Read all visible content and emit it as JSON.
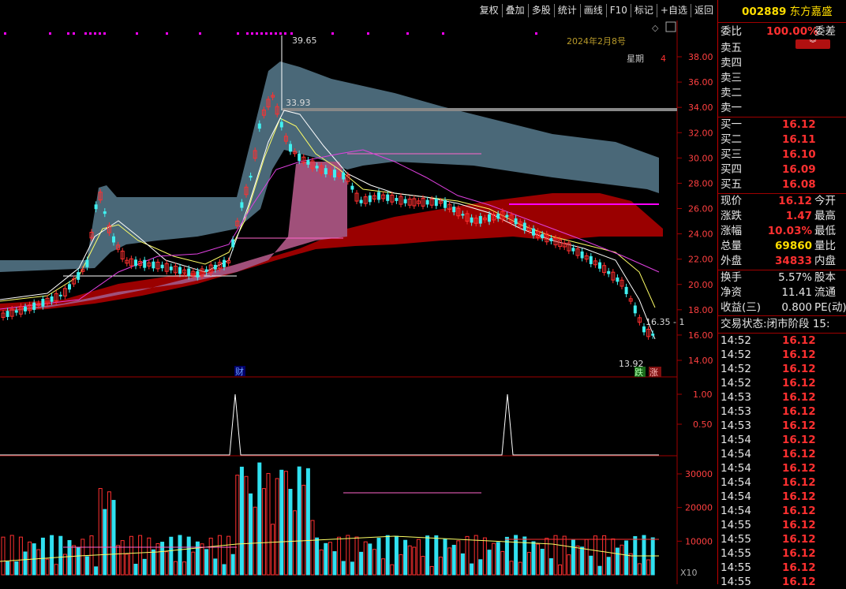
{
  "toolbar": [
    "复权",
    "叠加",
    "多股",
    "统计",
    "画线",
    "F10",
    "标记",
    "+自选",
    "返回"
  ],
  "stock": {
    "code": "002889",
    "name": "东方嘉盛"
  },
  "chart": {
    "date_label": "2024年2月8号",
    "weekday_label": "星期",
    "weekday_value": "4",
    "high_label": "39.65",
    "label_3393": "33.93",
    "low_label": "13.92",
    "right_label": "16.35 - 1",
    "fin_marker": "财",
    "die_marker": "跌",
    "zhang_marker": "涨",
    "x10_label": "X10",
    "price_ticks": [
      "38.00",
      "36.00",
      "34.00",
      "32.00",
      "30.00",
      "28.00",
      "26.00",
      "24.00",
      "22.00",
      "20.00",
      "18.00",
      "16.00",
      "14.00"
    ],
    "ind_ticks": [
      "1.00",
      "0.50"
    ],
    "vol_ticks": [
      "30000",
      "20000",
      "10000"
    ]
  },
  "chart_data": {
    "type": "candlestick",
    "price_axis": {
      "ticks": [
        38,
        36,
        34,
        32,
        30,
        28,
        26,
        24,
        22,
        20,
        18,
        16,
        14
      ]
    },
    "marked_high": 39.65,
    "marked_low": 13.92,
    "indicator_axis": {
      "ticks": [
        1.0,
        0.5
      ]
    },
    "volume_axis": {
      "ticks": [
        30000,
        20000,
        10000
      ]
    }
  },
  "side": {
    "weibi": {
      "label": "委比",
      "value": "100.00%",
      "label2": "委差"
    },
    "sells": [
      {
        "label": "卖五"
      },
      {
        "label": "卖四"
      },
      {
        "label": "卖三"
      },
      {
        "label": "卖二"
      },
      {
        "label": "卖一"
      }
    ],
    "buys": [
      {
        "label": "买一",
        "price": "16.12"
      },
      {
        "label": "买二",
        "price": "16.11"
      },
      {
        "label": "买三",
        "price": "16.10"
      },
      {
        "label": "买四",
        "price": "16.09"
      },
      {
        "label": "买五",
        "price": "16.08"
      }
    ],
    "quote": [
      {
        "label": "现价",
        "value": "16.12",
        "label2": "今开",
        "color": "red"
      },
      {
        "label": "涨跌",
        "value": "1.47",
        "label2": "最高",
        "color": "red"
      },
      {
        "label": "涨幅",
        "value": "10.03%",
        "label2": "最低",
        "color": "red"
      },
      {
        "label": "总量",
        "value": "69860",
        "label2": "量比",
        "color": "yel"
      },
      {
        "label": "外盘",
        "value": "34833",
        "label2": "内盘",
        "color": "red"
      }
    ],
    "stats": [
      {
        "label": "换手",
        "value": "5.57%",
        "label2": "股本"
      },
      {
        "label": "净资",
        "value": "11.41",
        "label2": "流通"
      },
      {
        "label": "收益(三)",
        "value": "0.800",
        "label2": "PE(动)"
      }
    ],
    "trade_status": "交易状态:闭市阶段 15:",
    "ticks": [
      {
        "time": "14:52",
        "price": "16.12"
      },
      {
        "time": "14:52",
        "price": "16.12"
      },
      {
        "time": "14:52",
        "price": "16.12"
      },
      {
        "time": "14:52",
        "price": "16.12"
      },
      {
        "time": "14:53",
        "price": "16.12"
      },
      {
        "time": "14:53",
        "price": "16.12"
      },
      {
        "time": "14:53",
        "price": "16.12"
      },
      {
        "time": "14:54",
        "price": "16.12"
      },
      {
        "time": "14:54",
        "price": "16.12"
      },
      {
        "time": "14:54",
        "price": "16.12"
      },
      {
        "time": "14:54",
        "price": "16.12"
      },
      {
        "time": "14:54",
        "price": "16.12"
      },
      {
        "time": "14:54",
        "price": "16.12"
      },
      {
        "time": "14:55",
        "price": "16.12"
      },
      {
        "time": "14:55",
        "price": "16.12"
      },
      {
        "time": "14:55",
        "price": "16.12"
      },
      {
        "time": "14:55",
        "price": "16.12"
      },
      {
        "time": "14:55",
        "price": "16.12"
      }
    ]
  }
}
